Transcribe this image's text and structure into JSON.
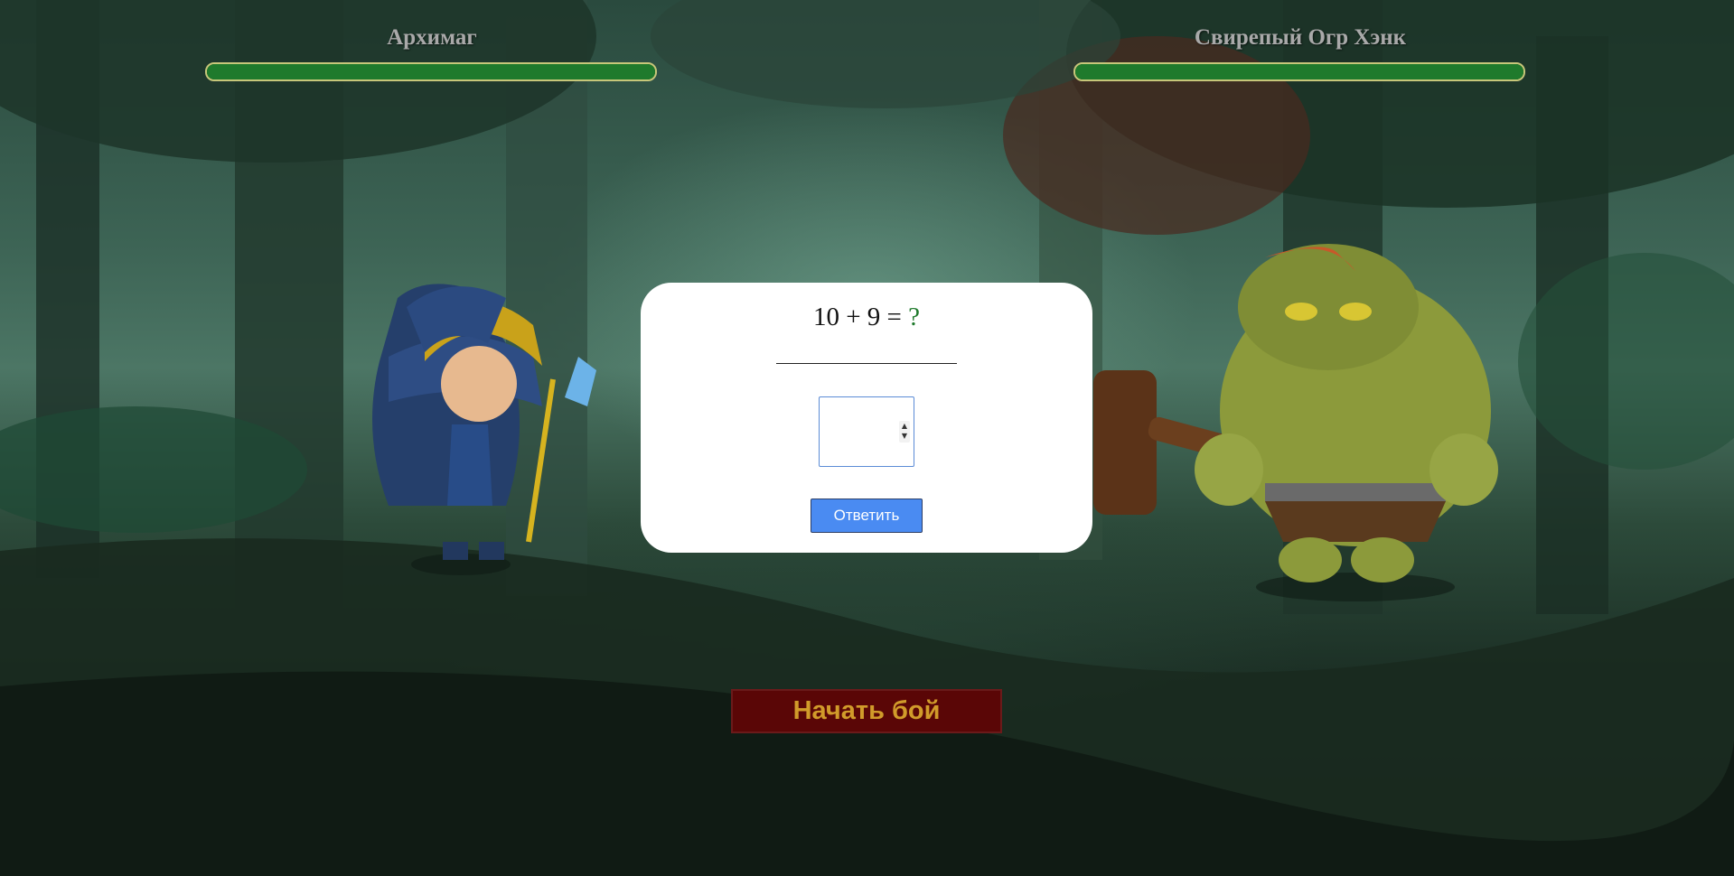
{
  "player": {
    "name": "Архимаг",
    "hp": 1.0,
    "hp_color": "#1f7a2c"
  },
  "enemy": {
    "name": "Свирепый Огр Хэнк",
    "hp": 1.0,
    "hp_color": "#1f7a2c"
  },
  "quiz": {
    "question": "10 + 9 = ",
    "unknown": "?",
    "answer_value": "",
    "spinner_up": "▲",
    "spinner_down": "▼",
    "submit_label": "Ответить"
  },
  "battle": {
    "start_label": "Начать бой",
    "start_color": "#5a0606",
    "start_text_color": "#d19b2a"
  },
  "sprites": {
    "player_sprite": "archmage-wizard",
    "enemy_sprite": "ogre-with-hammer",
    "background": "dark-forest"
  }
}
